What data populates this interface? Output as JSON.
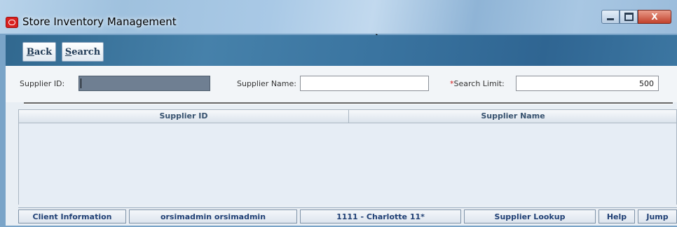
{
  "window": {
    "title": "Store Inventory Management",
    "controls": {
      "minimize": "_",
      "maximize": "□",
      "close": "X"
    }
  },
  "toolbar": {
    "back": {
      "mnemonic": "B",
      "rest": "ack"
    },
    "search": {
      "mnemonic": "S",
      "rest": "earch"
    }
  },
  "search_form": {
    "supplier_id_label": "Supplier ID:",
    "supplier_id_value": "",
    "supplier_name_label": "Supplier Name:",
    "supplier_name_value": "",
    "required_mark": "*",
    "search_limit_label": "Search Limit:",
    "search_limit_value": "500"
  },
  "grid": {
    "columns": [
      "Supplier ID",
      "Supplier Name"
    ],
    "rows": []
  },
  "status_bar": {
    "client_information": "Client Information",
    "user": "orsimadmin orsimadmin",
    "store": "1111 - Charlotte 11*",
    "screen": "Supplier Lookup",
    "help": "Help",
    "jump": "Jump"
  },
  "icons": {
    "app": "oracle-app-icon",
    "cursor": "mouse-pointer-icon"
  },
  "colors": {
    "toolbar_accent": "#3a74a0",
    "status_text": "#1f3f74",
    "required": "#d21c1c"
  }
}
